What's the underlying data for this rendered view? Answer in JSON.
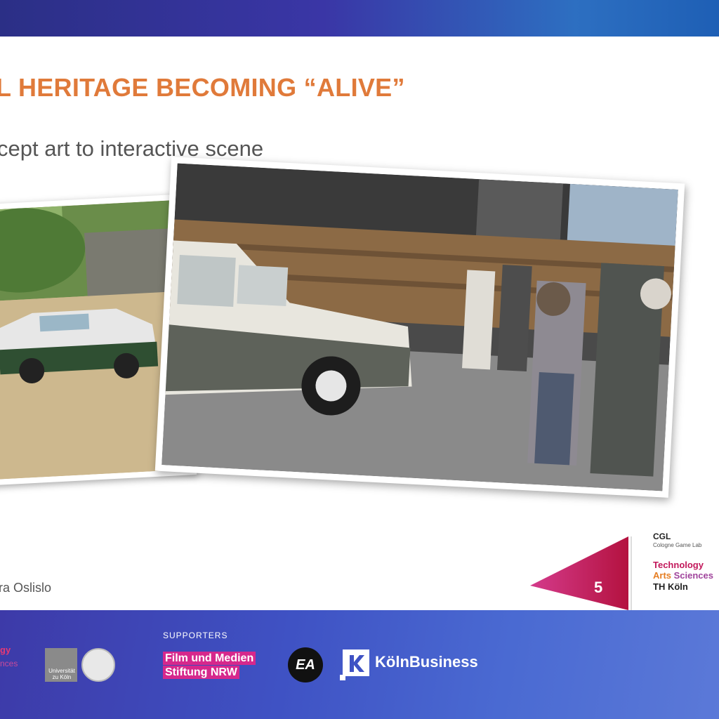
{
  "slide": {
    "title": "L HERITAGE BECOMING “ALIVE”",
    "subtitle": "cept art to interactive scene",
    "author": "ra Oslislo",
    "page_number": "5"
  },
  "branding": {
    "cgl": "CGL",
    "cgl_sub": "Cologne Game Lab",
    "th_line1": "Technology",
    "th_line2a": "Arts",
    "th_line2b": " Sciences",
    "th_line3": "TH Köln"
  },
  "footer": {
    "left_logo_line1": "gy",
    "left_logo_line2": "nces",
    "uni_line1": "Universität",
    "uni_line2": "zu Köln",
    "supporters_label": "SUPPORTERS",
    "film_line1": "Film und Medien",
    "film_line2": "Stiftung NRW",
    "ea_label": "EA",
    "koeln_business": "KölnBusiness"
  },
  "colors": {
    "title_orange": "#e07a3a",
    "accent_magenta": "#c2185b",
    "band_blue": "#3f52c4"
  }
}
